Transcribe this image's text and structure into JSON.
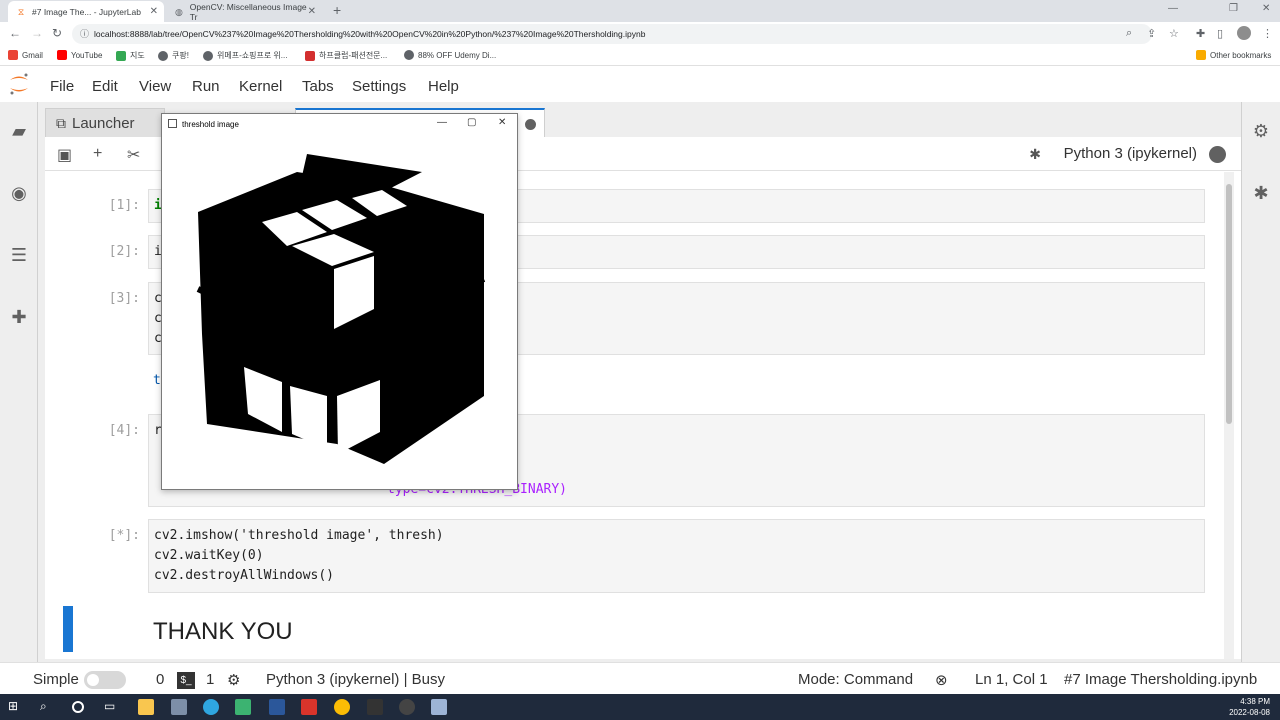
{
  "browser": {
    "tabs": [
      {
        "title": "#7 Image The... - JupyterLab",
        "active": true
      },
      {
        "title": "OpenCV: Miscellaneous Image Tr",
        "active": false
      }
    ],
    "url": "localhost:8888/lab/tree/OpenCV%237%20Image%20Thersholding%20with%20OpenCV%20in%20Python/%237%20Image%20Thersholding.ipynb",
    "bookmarks": [
      "Gmail",
      "YouTube",
      "지도",
      "쿠팡!",
      "위메프-쇼핑프로 위...",
      "하프클럽-패션전문...",
      "88% OFF Udemy Di..."
    ],
    "other_bookmarks": "Other bookmarks"
  },
  "jupyter": {
    "menu": [
      "File",
      "Edit",
      "View",
      "Run",
      "Kernel",
      "Tabs",
      "Settings",
      "Help"
    ],
    "doc_tabs": [
      {
        "label": "Launcher"
      }
    ],
    "kernel": "Python 3 (ipykernel)"
  },
  "cells": [
    {
      "prompt": "[1]:",
      "lines": [
        "i"
      ]
    },
    {
      "prompt": "[2]:",
      "lines": [
        "i"
      ]
    },
    {
      "prompt": "[3]:",
      "lines": [
        "c",
        "c",
        "c"
      ],
      "output": "th"
    },
    {
      "prompt": "[4]:",
      "lines": [
        "r"
      ],
      "tail": "type=cv2.THRESH_BINARY)"
    },
    {
      "prompt": "[*]:",
      "lines": [
        "cv2.imshow('threshold image', thresh)",
        "cv2.waitKey(0)",
        "cv2.destroyAllWindows()"
      ]
    }
  ],
  "markdown": {
    "heading": "THANK YOU"
  },
  "status": {
    "mode_label": "Simple",
    "count_a": "0",
    "count_b": "1",
    "kernel_status": "Python 3 (ipykernel) | Busy",
    "mode": "Mode: Command",
    "cursor": "Ln 1, Col 1",
    "filename": "#7 Image Thersholding.ipynb"
  },
  "cv_window": {
    "title": "threshold image"
  },
  "taskbar": {
    "time": "4:38 PM",
    "date": "2022-08-08"
  }
}
